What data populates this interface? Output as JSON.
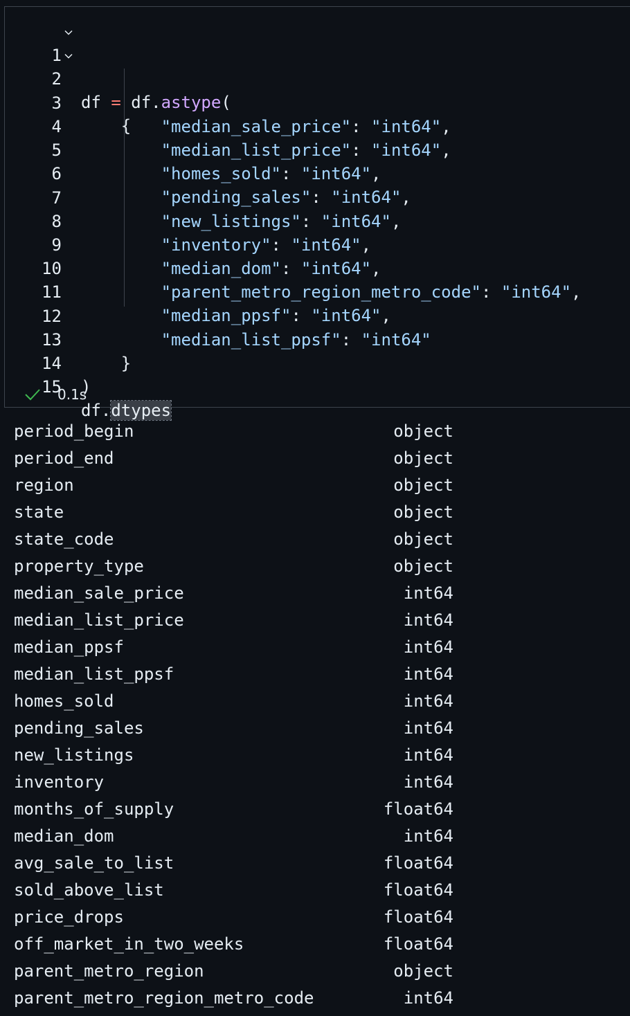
{
  "cell": {
    "lines": [
      {
        "n": "1",
        "fold": true
      },
      {
        "n": "2",
        "fold": true
      },
      {
        "n": "3",
        "fold": false
      },
      {
        "n": "4",
        "fold": false
      },
      {
        "n": "5",
        "fold": false
      },
      {
        "n": "6",
        "fold": false
      },
      {
        "n": "7",
        "fold": false
      },
      {
        "n": "8",
        "fold": false
      },
      {
        "n": "9",
        "fold": false
      },
      {
        "n": "10",
        "fold": false
      },
      {
        "n": "11",
        "fold": false
      },
      {
        "n": "12",
        "fold": false
      },
      {
        "n": "13",
        "fold": false
      },
      {
        "n": "14",
        "fold": false
      },
      {
        "n": "15",
        "fold": false
      }
    ],
    "code": {
      "l1_var": "df",
      "l1_eq": "=",
      "l1_obj": "df.",
      "l1_method": "astype",
      "l1_paren": "(",
      "l2": "{",
      "pairs": [
        {
          "key": "\"median_sale_price\"",
          "val": "\"int64\"",
          "sep": ","
        },
        {
          "key": "\"median_list_price\"",
          "val": "\"int64\"",
          "sep": ","
        },
        {
          "key": "\"homes_sold\"",
          "val": "\"int64\"",
          "sep": ","
        },
        {
          "key": "\"pending_sales\"",
          "val": "\"int64\"",
          "sep": ","
        },
        {
          "key": "\"new_listings\"",
          "val": "\"int64\"",
          "sep": ","
        },
        {
          "key": "\"inventory\"",
          "val": "\"int64\"",
          "sep": ","
        },
        {
          "key": "\"median_dom\"",
          "val": "\"int64\"",
          "sep": ","
        },
        {
          "key": "\"parent_metro_region_metro_code\"",
          "val": "\"int64\"",
          "sep": ","
        },
        {
          "key": "\"median_ppsf\"",
          "val": "\"int64\"",
          "sep": ","
        },
        {
          "key": "\"median_list_ppsf\"",
          "val": "\"int64\"",
          "sep": ""
        }
      ],
      "colon": ":",
      "l13": "}",
      "l14": ")",
      "l15_obj": "df.",
      "l15_attr": "dtypes"
    },
    "status": {
      "icon": "check-icon",
      "time": "0.1s",
      "color": "#3fb950"
    }
  },
  "output": {
    "rows": [
      {
        "name": "period_begin",
        "type": "object"
      },
      {
        "name": "period_end",
        "type": "object"
      },
      {
        "name": "region",
        "type": "object"
      },
      {
        "name": "state",
        "type": "object"
      },
      {
        "name": "state_code",
        "type": "object"
      },
      {
        "name": "property_type",
        "type": "object"
      },
      {
        "name": "median_sale_price",
        "type": "int64"
      },
      {
        "name": "median_list_price",
        "type": "int64"
      },
      {
        "name": "median_ppsf",
        "type": "int64"
      },
      {
        "name": "median_list_ppsf",
        "type": "int64"
      },
      {
        "name": "homes_sold",
        "type": "int64"
      },
      {
        "name": "pending_sales",
        "type": "int64"
      },
      {
        "name": "new_listings",
        "type": "int64"
      },
      {
        "name": "inventory",
        "type": "int64"
      },
      {
        "name": "months_of_supply",
        "type": "float64"
      },
      {
        "name": "median_dom",
        "type": "int64"
      },
      {
        "name": "avg_sale_to_list",
        "type": "float64"
      },
      {
        "name": "sold_above_list",
        "type": "float64"
      },
      {
        "name": "price_drops",
        "type": "float64"
      },
      {
        "name": "off_market_in_two_weeks",
        "type": "float64"
      },
      {
        "name": "parent_metro_region",
        "type": "object"
      },
      {
        "name": "parent_metro_region_metro_code",
        "type": "int64"
      }
    ]
  }
}
